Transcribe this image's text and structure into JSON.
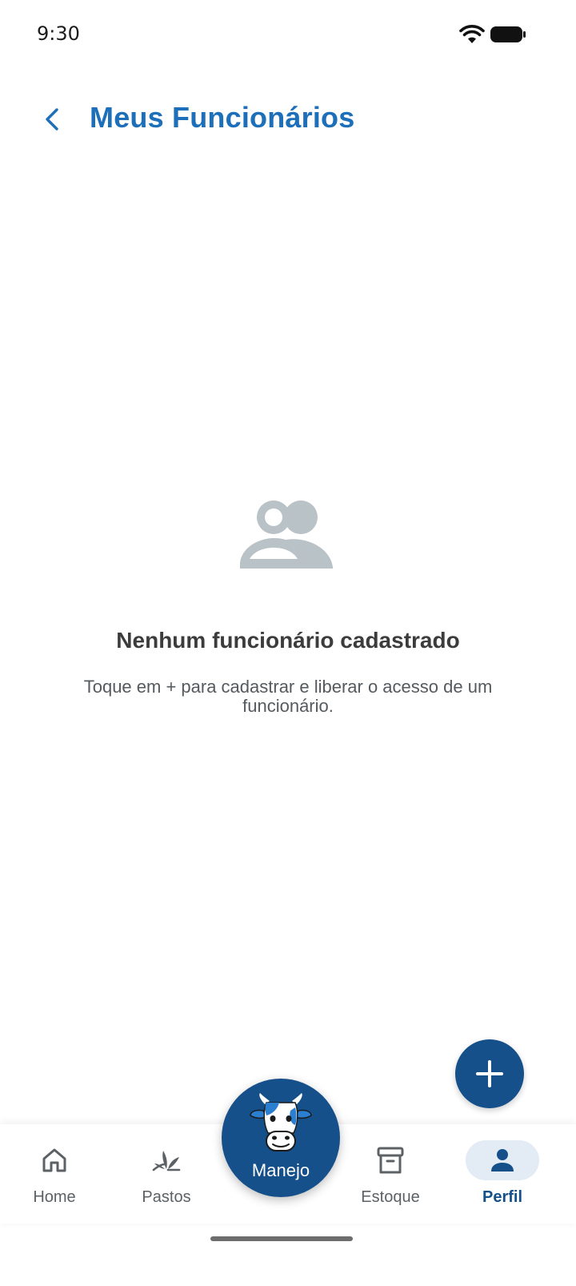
{
  "status_bar": {
    "time": "9:30"
  },
  "header": {
    "title": "Meus Funcionários"
  },
  "empty_state": {
    "title": "Nenhum funcionário cadastrado",
    "description": "Toque em + para cadastrar e liberar o acesso de um funcionário."
  },
  "bottom_nav": {
    "items": [
      {
        "label": "Home",
        "icon": "home-icon"
      },
      {
        "label": "Pastos",
        "icon": "grass-icon"
      },
      {
        "label": "Manejo",
        "icon": "cow-icon"
      },
      {
        "label": "Estoque",
        "icon": "archive-icon"
      },
      {
        "label": "Perfil",
        "icon": "person-icon",
        "active": true
      }
    ]
  },
  "colors": {
    "primary": "#15508a",
    "title_blue": "#1c6fb8",
    "icon_gray": "#b9c2c6",
    "nav_active_bg": "#e3ebf4"
  }
}
